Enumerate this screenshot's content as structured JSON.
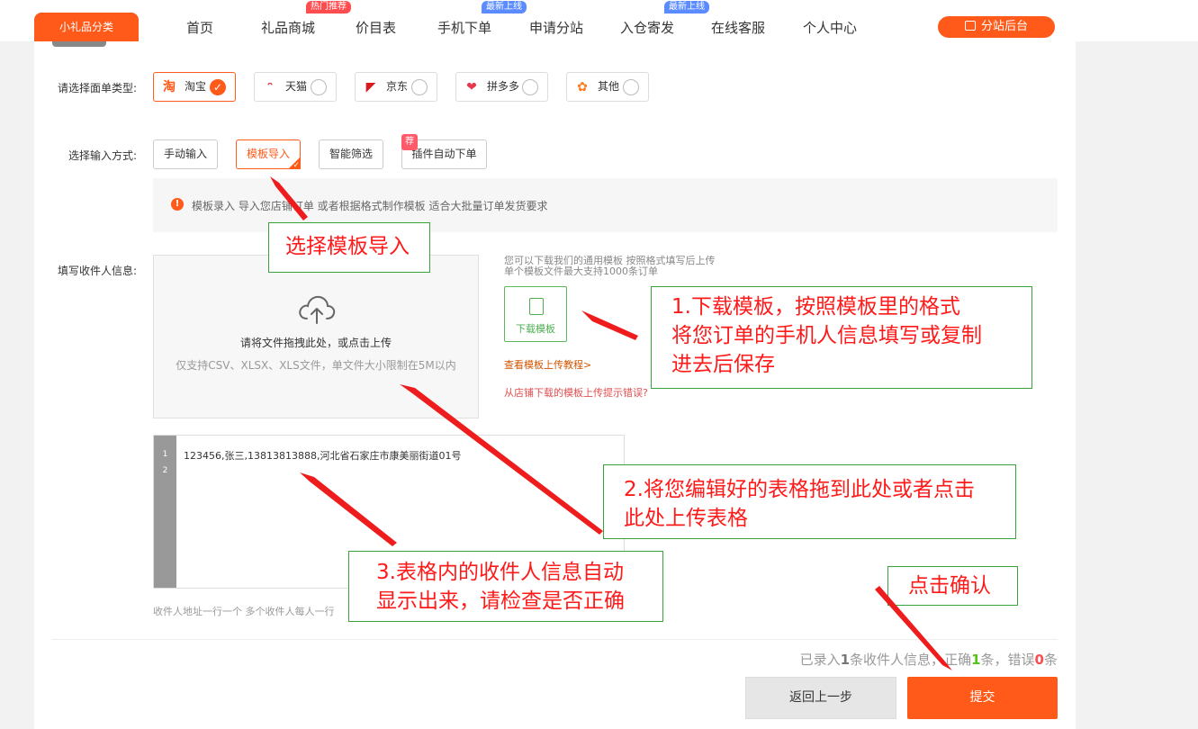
{
  "header": {
    "category_button": "小礼品分类",
    "nav": [
      {
        "label": "首页",
        "badge": ""
      },
      {
        "label": "礼品商城",
        "badge": "热门推荐"
      },
      {
        "label": "价目表",
        "badge": ""
      },
      {
        "label": "手机下单",
        "badge": "最新上线"
      },
      {
        "label": "申请分站",
        "badge": ""
      },
      {
        "label": "入仓寄发",
        "badge": "最新上线"
      },
      {
        "label": "在线客服",
        "badge": ""
      },
      {
        "label": "个人中心",
        "badge": ""
      }
    ],
    "admin_button": "分站后台"
  },
  "form": {
    "platform_label": "请选择面单类型:",
    "platforms": [
      {
        "label": "淘宝",
        "selected": true,
        "color": "#ff5a1a"
      },
      {
        "label": "天猫",
        "selected": false,
        "color": "#e3323c"
      },
      {
        "label": "京东",
        "selected": false,
        "color": "#d71920"
      },
      {
        "label": "拼多多",
        "selected": false,
        "color": "#e8394a"
      },
      {
        "label": "其他",
        "selected": false,
        "color": "#ff7a1a"
      }
    ],
    "input_mode_label": "选择输入方式:",
    "input_modes": [
      {
        "label": "手动输入",
        "selected": false
      },
      {
        "label": "模板导入",
        "selected": true
      },
      {
        "label": "智能筛选",
        "selected": false
      },
      {
        "label": "插件自动下单",
        "selected": false
      }
    ],
    "recommend_tag": "荐",
    "notice": "模板录入 导入您店铺订单 或者根据格式制作模板 适合大批量订单发货要求",
    "recipient_label": "填写收件人信息:",
    "upload": {
      "primary_text": "请将文件拖拽此处，或点击上传",
      "secondary_text": "仅支持CSV、XLSX、XLS文件，单文件大小限制在5M以内"
    },
    "template_tip_line1": "您可以下载我们的通用模板 按照格式填写后上传",
    "template_tip_line2": "单个模板文件最大支持1000条订单",
    "download_template_button": "下载模板",
    "tutorial_link": "查看模板上传教程>",
    "error_help_link": "从店铺下载的模板上传提示错误?",
    "editor": {
      "line_numbers": [
        "1",
        "2"
      ],
      "content": "123456,张三,13813813888,河北省石家庄市康美丽街道01号"
    },
    "editor_hint": "收件人地址一行一个 多个收件人每人一行"
  },
  "summary": {
    "prefix": "已录入",
    "total": "1",
    "mid1": "条收件人信息，",
    "partial_word": "正",
    "mid2": "确",
    "correct": "1",
    "mid3": "条，错误",
    "errors": "0",
    "suffix": "条"
  },
  "buttons": {
    "back": "返回上一步",
    "submit": "提交"
  },
  "annotations": {
    "select_template": "选择模板导入",
    "step1_line1": "1.下载模板，按照模板里的格式",
    "step1_line2": "将您订单的手机人信息填写或复制",
    "step1_line3": "进去后保存",
    "step2_line1": "2.将您编辑好的表格拖到此处或者点击",
    "step2_line2": "此处上传表格",
    "step3_line1": "3.表格内的收件人信息自动",
    "step3_line2": "显示出来，请检查是否正确",
    "confirm": "点击确认"
  }
}
